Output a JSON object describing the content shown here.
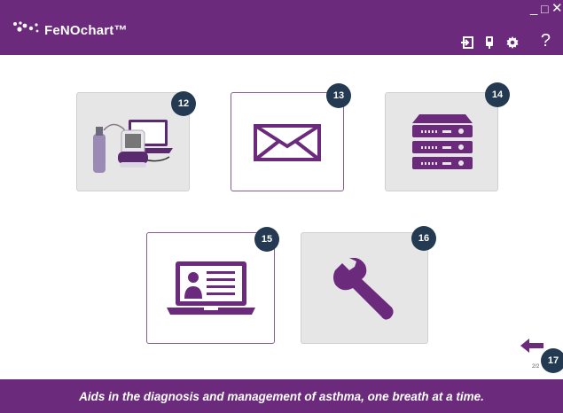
{
  "window": {
    "title": "FeNOchart™",
    "minimize": "_",
    "maximize": "□",
    "close": "✕"
  },
  "toolbar": {
    "help_label": "?"
  },
  "tiles": [
    {
      "name": "device-setup",
      "badge": "12"
    },
    {
      "name": "email",
      "badge": "13"
    },
    {
      "name": "server",
      "badge": "14"
    },
    {
      "name": "online-profile",
      "badge": "15"
    },
    {
      "name": "maintenance",
      "badge": "16"
    }
  ],
  "navigation": {
    "back_badge": "17",
    "page_indicator": "2/2"
  },
  "footer": {
    "tagline": "Aids in the diagnosis and management of asthma, one breath at a time."
  },
  "colors": {
    "brand": "#6b2a7c",
    "badge": "#233a52",
    "tile_gray": "#e6e6e6"
  }
}
